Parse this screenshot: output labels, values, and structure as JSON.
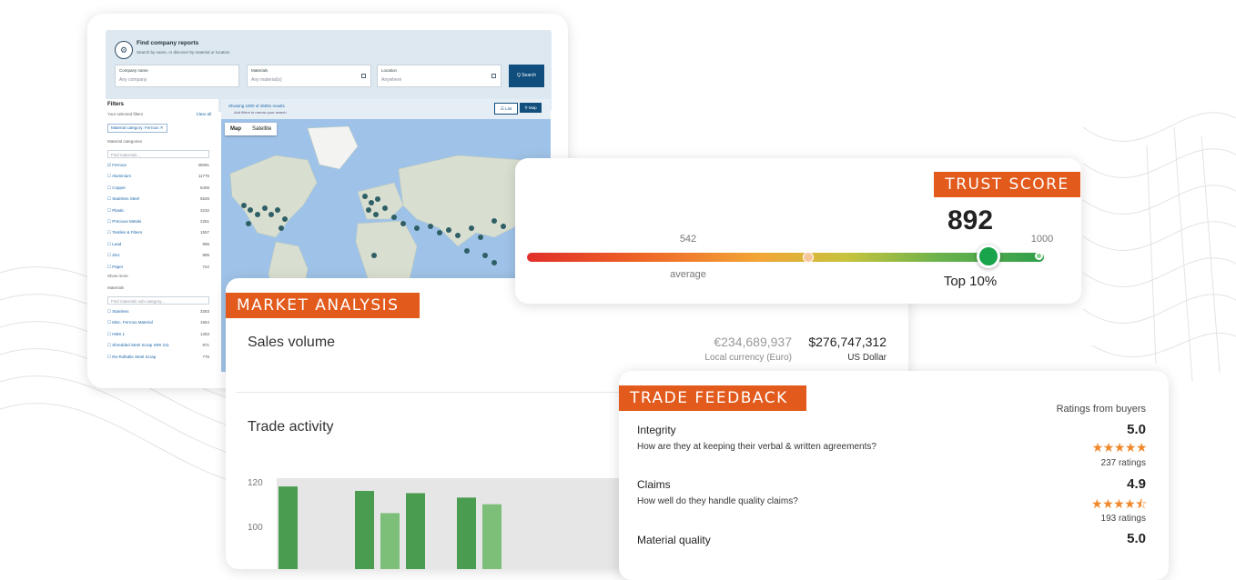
{
  "app": {
    "panel_title": "Find company reports",
    "panel_subtitle": "Search by name, or discover by material or location",
    "company_label": "Company name",
    "company_placeholder": "Any company",
    "materials_label": "Materials",
    "materials_placeholder": "Any material(s)",
    "location_label": "Location",
    "location_placeholder": "Anywhere",
    "search_button": "Q  Search",
    "filters_title": "Filters",
    "your_selected_filters": "Your selected filters",
    "clear_all": "Clear all",
    "chip": "Material category: Ferrous ✕",
    "material_categories": "Material categories",
    "find_materials": "Find materials...",
    "categories": [
      {
        "label": "☑ Ferrous",
        "count": "45091"
      },
      {
        "label": "☐ Aluminium",
        "count": "11775"
      },
      {
        "label": "☐ Copper",
        "count": "8406"
      },
      {
        "label": "☐ Stainless Steel",
        "count": "5526"
      },
      {
        "label": "☐ Plastic",
        "count": "3232"
      },
      {
        "label": "☐ Precious Metals",
        "count": "2251"
      },
      {
        "label": "☐ Textiles & Fibers",
        "count": "1557"
      },
      {
        "label": "☐ Lead",
        "count": "995"
      },
      {
        "label": "☐ Zinc",
        "count": "985"
      },
      {
        "label": "☐ Paper",
        "count": "742"
      }
    ],
    "show_more": "Show more",
    "materials_title": "Materials",
    "find_subcategory": "Find materials sub-category...",
    "materials": [
      {
        "label": "☐ Stainless",
        "count": "3283"
      },
      {
        "label": "☐ Misc. Ferrous Material",
        "count": "1654"
      },
      {
        "label": "☐ HMS 1",
        "count": "1283"
      },
      {
        "label": "☐ Shredded Steel Scrap ISRI 211",
        "count": "871"
      },
      {
        "label": "☐ Re-Rollable Steel Scrap",
        "count": "775"
      }
    ],
    "map_info": "Showing 1000 of 45091 results",
    "map_info2": "Add filters to narrow your search",
    "list_btn": "☰ List",
    "map_btn": "⚲ Map",
    "map_tab": "Map",
    "satellite_tab": "Satellite"
  },
  "trust": {
    "banner": "TRUST SCORE",
    "score": "892",
    "average_value": "542",
    "max_value": "1000",
    "average_label": "average",
    "rank": "Top 10%",
    "score_fraction": 0.892,
    "average_fraction": 0.542
  },
  "market": {
    "banner": "MARKET ANALYSIS",
    "sales_label": "Sales volume",
    "eur_value": "€234,689,937",
    "usd_value": "$276,747,312",
    "eur_sub": "Local currency (Euro)",
    "usd_sub": "US Dollar",
    "trade_label": "Trade activity"
  },
  "feedback": {
    "banner": "TRADE FEEDBACK",
    "ratings_header": "Ratings from buyers",
    "items": [
      {
        "title": "Integrity",
        "question": "How are they at keeping their verbal & written agreements?",
        "score": "5.0",
        "stars": "★★★★★",
        "ratings": "237 ratings"
      },
      {
        "title": "Claims",
        "question": "How well do they handle quality claims?",
        "score": "4.9",
        "stars": "★★★★⯪",
        "ratings": "193 ratings"
      },
      {
        "title": "Material quality",
        "question": "",
        "score": "5.0",
        "stars": "",
        "ratings": ""
      }
    ]
  },
  "chart_data": {
    "type": "bar",
    "y_ticks": [
      "120",
      "100"
    ],
    "ylim": [
      80,
      125
    ],
    "values": [
      118,
      0,
      0,
      116,
      106,
      115,
      0,
      113,
      110
    ],
    "colors": [
      "#4a9d50",
      "#4a9d50",
      "#4a9d50",
      "#4a9d50",
      "#7dbf78",
      "#4a9d50",
      "#4a9d50",
      "#4a9d50",
      "#7dbf78"
    ]
  }
}
